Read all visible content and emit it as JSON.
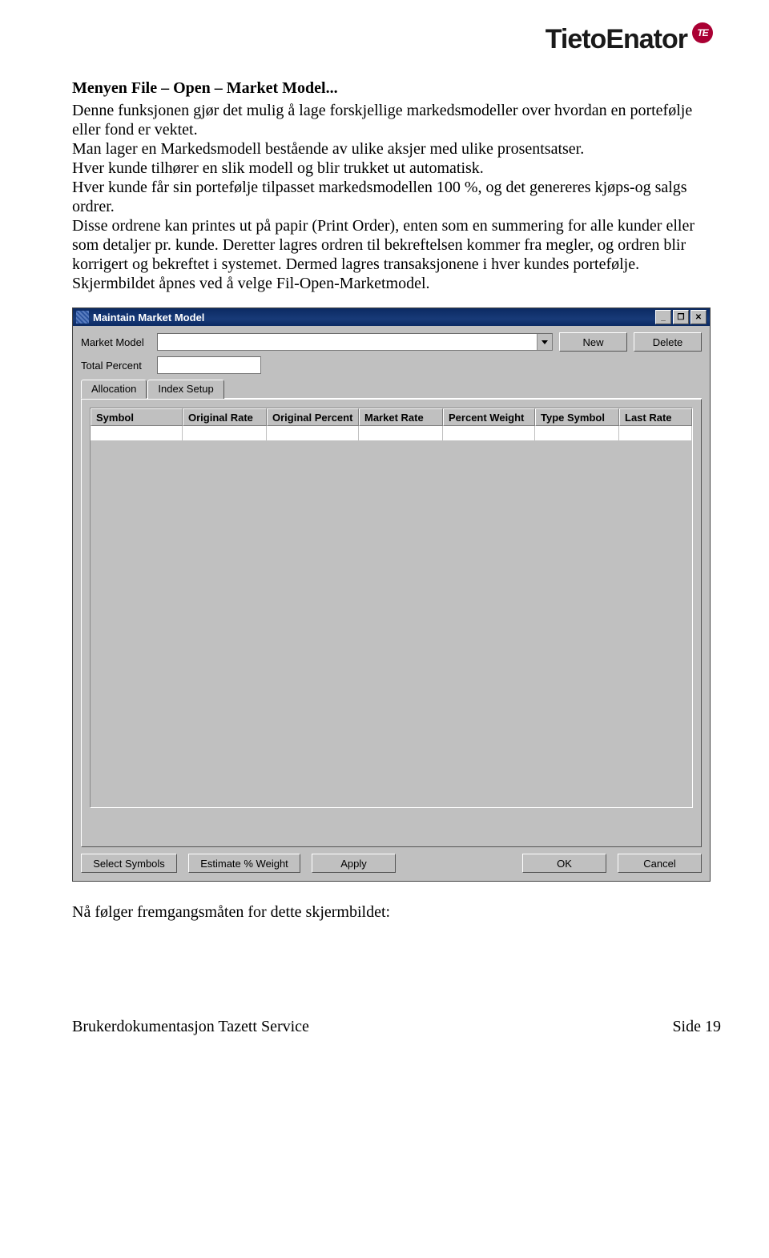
{
  "logo": {
    "text": "TietoEnator",
    "badge": "TE"
  },
  "heading": "Menyen File – Open – Market Model...",
  "paragraphs": [
    "Denne funksjonen gjør det mulig å lage forskjellige markedsmodeller over hvordan en portefølje eller fond er vektet.",
    "Man lager en Markedsmodell bestående av ulike aksjer med ulike prosentsatser.",
    "Hver kunde tilhører en slik modell og blir trukket ut automatisk.",
    "Hver kunde får sin portefølje tilpasset markedsmodellen 100 %, og det genereres kjøps-og salgs ordrer.",
    "Disse ordrene kan printes ut på papir (Print Order), enten som en summering for alle kunder eller som detaljer pr. kunde. Deretter lagres ordren til bekreftelsen kommer fra megler, og ordren blir korrigert og bekreftet i systemet. Dermed lagres transaksjonene i hver kundes portefølje.",
    "Skjermbildet åpnes ved å velge Fil-Open-Marketmodel."
  ],
  "dialog": {
    "title": "Maintain Market Model",
    "labels": {
      "market_model": "Market Model",
      "total_percent": "Total Percent"
    },
    "buttons": {
      "new": "New",
      "delete": "Delete"
    },
    "tabs": {
      "allocation": "Allocation",
      "index_setup": "Index Setup"
    },
    "grid_headers": [
      "Symbol",
      "Original Rate",
      "Original Percent",
      "Market Rate",
      "Percent Weight",
      "Type Symbol",
      "Last Rate"
    ],
    "bottom_buttons": [
      "Select Symbols",
      "Estimate % Weight",
      "Apply",
      "OK",
      "Cancel"
    ],
    "window_controls": {
      "minimize": "_",
      "restore": "❐",
      "close": "✕"
    }
  },
  "after_text": "Nå følger fremgangsmåten for dette skjermbildet:",
  "footer": {
    "left": "Brukerdokumentasjon Tazett Service",
    "right": "Side 19"
  }
}
